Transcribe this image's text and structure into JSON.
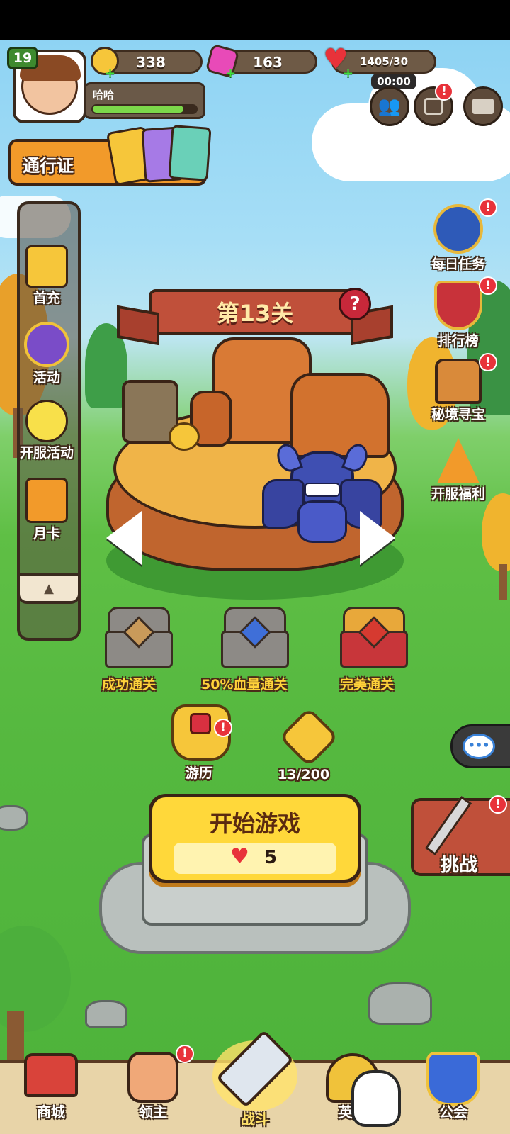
{
  "player": {
    "level": "19",
    "name": "哈哈",
    "exp_progress": 0.88
  },
  "resources": {
    "gold": "338",
    "gems": "163",
    "stamina": "1405/30",
    "stamina_timer": "00:00"
  },
  "pass": {
    "label": "通行证"
  },
  "left_menu": [
    {
      "label": "首充",
      "icon": "gift-icon"
    },
    {
      "label": "活动",
      "icon": "star-medal-icon"
    },
    {
      "label": "开服活动",
      "icon": "balloon-icon"
    },
    {
      "label": "月卡",
      "icon": "monthly-card-icon"
    }
  ],
  "right_menu": [
    {
      "label": "每日任务",
      "icon": "compass-star-icon",
      "badge": "!"
    },
    {
      "label": "排行榜",
      "icon": "shield-rank-icon",
      "badge": "!"
    },
    {
      "label": "秘境寻宝",
      "icon": "treasure-chest-icon",
      "badge": "!"
    },
    {
      "label": "开服福利",
      "icon": "party-hat-icon"
    }
  ],
  "stage": {
    "title": "第13关",
    "help_icon": "?"
  },
  "chests": [
    {
      "label": "成功通关",
      "color": "#c99a5a"
    },
    {
      "label": "50%血量通关",
      "color": "#3f6fd8"
    },
    {
      "label": "完美通关",
      "color": "#d63a30"
    }
  ],
  "travel": {
    "label": "游历",
    "badge": "!"
  },
  "stars": {
    "progress": "13/200"
  },
  "start_button": {
    "label": "开始游戏",
    "cost": "5"
  },
  "challenge": {
    "label": "挑战",
    "badge": "!"
  },
  "bottom_nav": [
    {
      "label": "商城",
      "icon": "shop-icon"
    },
    {
      "label": "领主",
      "icon": "fist-icon",
      "badge": "!"
    },
    {
      "label": "战斗",
      "icon": "crossed-swords-icon"
    },
    {
      "label": "英雄",
      "icon": "helmet-icon"
    },
    {
      "label": "公会",
      "icon": "guild-shield-icon"
    }
  ],
  "colors": {
    "accent_yellow": "#ffd83a",
    "banner_red": "#c0503a",
    "badge_red": "#e8323a",
    "grass": "#55b83f"
  }
}
